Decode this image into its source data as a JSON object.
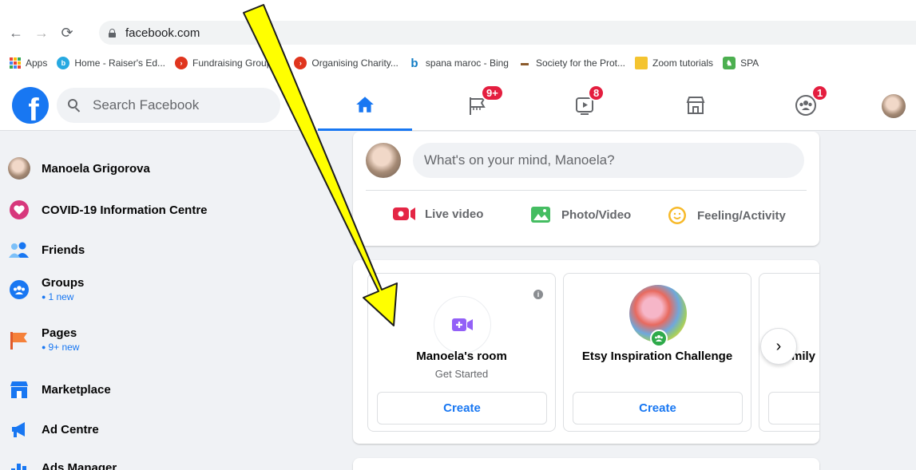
{
  "browser": {
    "url": "facebook.com",
    "bookmarks": [
      {
        "label": "Apps",
        "color": "#4285f4"
      },
      {
        "label": "Home - Raiser's Ed...",
        "color": "#27a9e1"
      },
      {
        "label": "Fundraising Groups...",
        "color": "#e0351e"
      },
      {
        "label": "Organising Charity...",
        "color": "#e0351e"
      },
      {
        "label": "spana maroc - Bing",
        "color": "#0f7bc4"
      },
      {
        "label": "Society for the Prot...",
        "color": "#8b5a2b"
      },
      {
        "label": "Zoom tutorials",
        "color": "#f4c430"
      },
      {
        "label": "SPA",
        "color": "#4caf50"
      }
    ]
  },
  "header": {
    "search_placeholder": "Search Facebook",
    "tabs": [
      {
        "name": "home",
        "badge": ""
      },
      {
        "name": "pages",
        "badge": "9+"
      },
      {
        "name": "watch",
        "badge": "8"
      },
      {
        "name": "marketplace",
        "badge": ""
      },
      {
        "name": "groups",
        "badge": "1"
      }
    ],
    "accent": "#1877f2"
  },
  "sidebar": {
    "items": [
      {
        "label": "Manoela Grigorova",
        "sub": ""
      },
      {
        "label": "COVID-19 Information Centre",
        "sub": ""
      },
      {
        "label": "Friends",
        "sub": ""
      },
      {
        "label": "Groups",
        "sub": "1 new"
      },
      {
        "label": "Pages",
        "sub": "9+ new"
      },
      {
        "label": "Marketplace",
        "sub": ""
      },
      {
        "label": "Ad Centre",
        "sub": ""
      },
      {
        "label": "Ads Manager",
        "sub": ""
      }
    ]
  },
  "composer": {
    "placeholder": "What's on your mind, Manoela?",
    "actions": [
      {
        "label": "Live video"
      },
      {
        "label": "Photo/Video"
      },
      {
        "label": "Feeling/Activity"
      }
    ]
  },
  "rooms": {
    "cards": [
      {
        "title": "Manoela's room",
        "sub": "Get Started",
        "button": "Create"
      },
      {
        "title": "Etsy Inspiration Challenge",
        "sub": "",
        "button": "Create"
      },
      {
        "title": "mily",
        "sub": "",
        "button": ""
      }
    ]
  }
}
